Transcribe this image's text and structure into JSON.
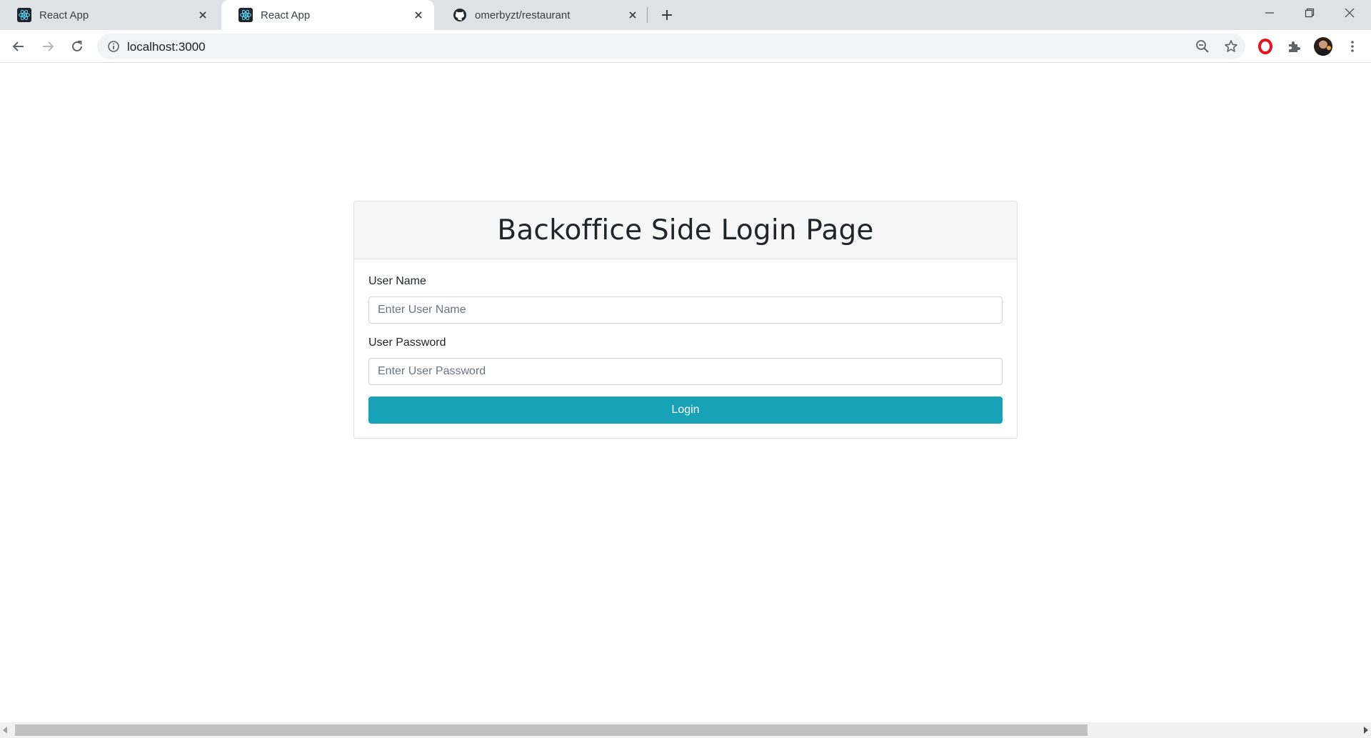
{
  "browser": {
    "tabs": [
      {
        "title": "React App",
        "icon": "react-icon",
        "active": false
      },
      {
        "title": "React App",
        "icon": "react-icon",
        "active": true
      },
      {
        "title": "omerbyzt/restaurant",
        "icon": "github-icon",
        "active": false
      }
    ],
    "address": {
      "url": "localhost:3000"
    },
    "colors": {
      "tabstrip": "#dee1e6",
      "accent": "#17a2b8"
    }
  },
  "page": {
    "title": "Backoffice Side Login Page",
    "username": {
      "label": "User Name",
      "placeholder": "Enter User Name",
      "value": ""
    },
    "password": {
      "label": "User Password",
      "placeholder": "Enter User Password",
      "value": ""
    },
    "login_label": "Login"
  }
}
